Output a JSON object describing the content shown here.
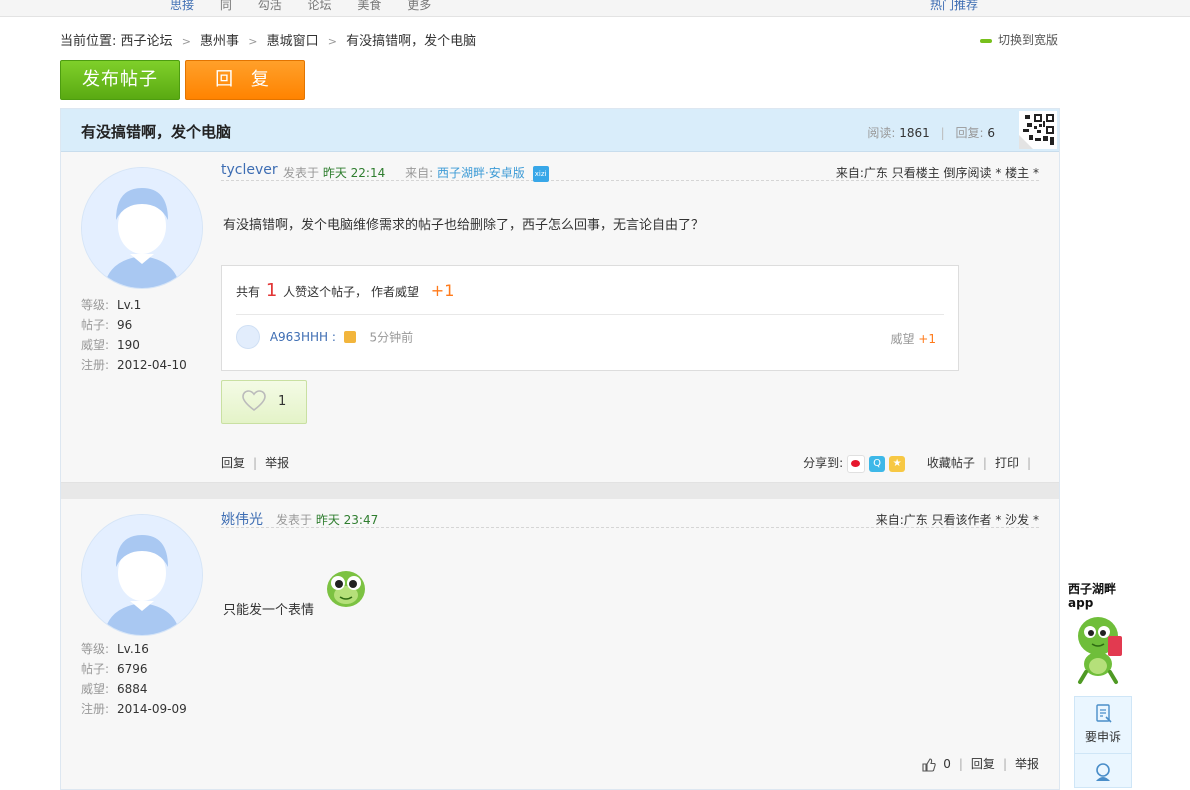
{
  "topbar": {
    "logo": "",
    "nav": [
      "",
      "思接",
      "同",
      "勾活",
      "论坛",
      "美食",
      "",
      "更多"
    ],
    "right": "热门推荐"
  },
  "breadcrumb": {
    "prefix": "当前位置:",
    "items": [
      "西子论坛",
      "惠州事",
      "惠城窗口",
      "有没搞错啊，发个电脑"
    ],
    "switch_label": "切换到宽版"
  },
  "actions": {
    "post_label": "发布帖子",
    "reply_label": "回 复"
  },
  "thread": {
    "title": "有没搞错啊，发个电脑",
    "read_label": "阅读:",
    "read_count": "1861",
    "reply_label": "回复:",
    "reply_count": "6"
  },
  "posts": [
    {
      "author": "tyclever",
      "posted_label": "发表于",
      "posted_time": "昨天 22:14",
      "from_label": "来自:",
      "from_source": "西子湖畔·安卓版",
      "app_badge": "xizi",
      "right_meta": "来自:广东 只看楼主 倒序阅读 * 楼主 *",
      "stats": [
        {
          "k": "等级:",
          "v": "Lv.1"
        },
        {
          "k": "帖子:",
          "v": "96"
        },
        {
          "k": "威望:",
          "v": "190"
        },
        {
          "k": "注册:",
          "v": "2012-04-10"
        }
      ],
      "content": "有没搞错啊，发个电脑维修需求的帖子也给删除了，西子怎么回事，无言论自由了？",
      "like_summary": {
        "pre": "共有",
        "count": "1",
        "post": "人赞这个帖子， 作者威望",
        "plus": "+1"
      },
      "liker": {
        "name": "A963HHH",
        "sep": ":",
        "time": "5分钟前",
        "reward_label": "威望",
        "reward_value": "+1"
      },
      "like_count": "1",
      "footer_left": [
        "回复",
        "举报"
      ],
      "share_label": "分享到:",
      "footer_right": [
        "收藏帖子",
        "打印"
      ]
    },
    {
      "author": "姚伟光",
      "posted_label": "发表于",
      "posted_time": "昨天 23:47",
      "right_meta": "来自:广东 只看该作者 * 沙发 *",
      "stats": [
        {
          "k": "等级:",
          "v": "Lv.16"
        },
        {
          "k": "帖子:",
          "v": "6796"
        },
        {
          "k": "威望:",
          "v": "6884"
        },
        {
          "k": "注册:",
          "v": "2014-09-09"
        }
      ],
      "content": "只能发一个表情",
      "like_count": "0",
      "footer_right": [
        "回复",
        "举报"
      ]
    }
  ],
  "sidebar": {
    "brand_line1": "西子湖畔",
    "brand_line2": "app",
    "complain_label": "要申诉"
  },
  "colors": {
    "green": "#5aaa12",
    "orange": "#ff8300",
    "header_blue": "#d9edfa",
    "link_blue": "#3d6db3"
  }
}
